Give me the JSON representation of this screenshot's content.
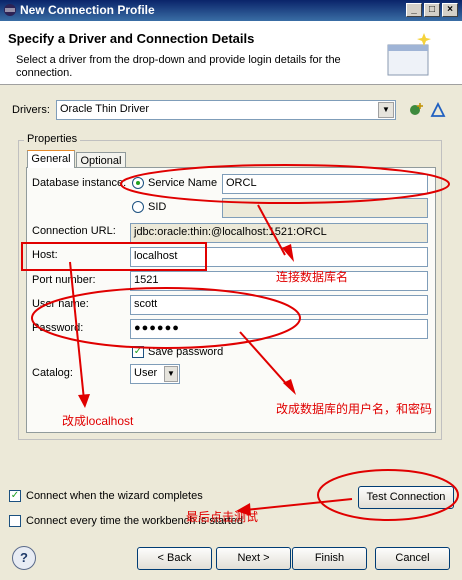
{
  "window": {
    "title": "New Connection Profile",
    "min": "_",
    "max": "□",
    "close": "×"
  },
  "header": {
    "title": "Specify a Driver and Connection Details",
    "description": "Select a driver from the drop-down and provide login details for the connection."
  },
  "drivers": {
    "label": "Drivers:",
    "value": "Oracle Thin Driver"
  },
  "properties": {
    "title": "Properties",
    "tabs": [
      {
        "label": "General"
      },
      {
        "label": "Optional"
      }
    ],
    "database_instance_label": "Database instance:",
    "service_name_label": "Service Name",
    "service_name_value": "ORCL",
    "sid_label": "SID",
    "sid_value": "",
    "connection_url_label": "Connection URL:",
    "connection_url_value": "jdbc:oracle:thin:@localhost:1521:ORCL",
    "host_label": "Host:",
    "host_value": "localhost",
    "port_label": "Port number:",
    "port_value": "1521",
    "user_label": "User name:",
    "user_value": "scott",
    "password_label": "Password:",
    "password_value": "●●●●●●",
    "save_password_label": "Save password",
    "catalog_label": "Catalog:",
    "catalog_value": "User"
  },
  "options": {
    "connect_when_complete": "Connect when the wizard completes",
    "connect_every_time": "Connect every time the workbench is started"
  },
  "buttons": {
    "test_connection": "Test Connection",
    "help": "?",
    "back": "< Back",
    "next": "Next >",
    "finish": "Finish",
    "cancel": "Cancel"
  },
  "annotations": {
    "db_name": "连接数据库名",
    "localhost": "改成localhost",
    "user_pwd": "改成数据库的用户名，和密码",
    "test_last": "最后点击测试"
  },
  "colors": {
    "annotation": "#e00000",
    "titlebar": "#0a246a"
  }
}
